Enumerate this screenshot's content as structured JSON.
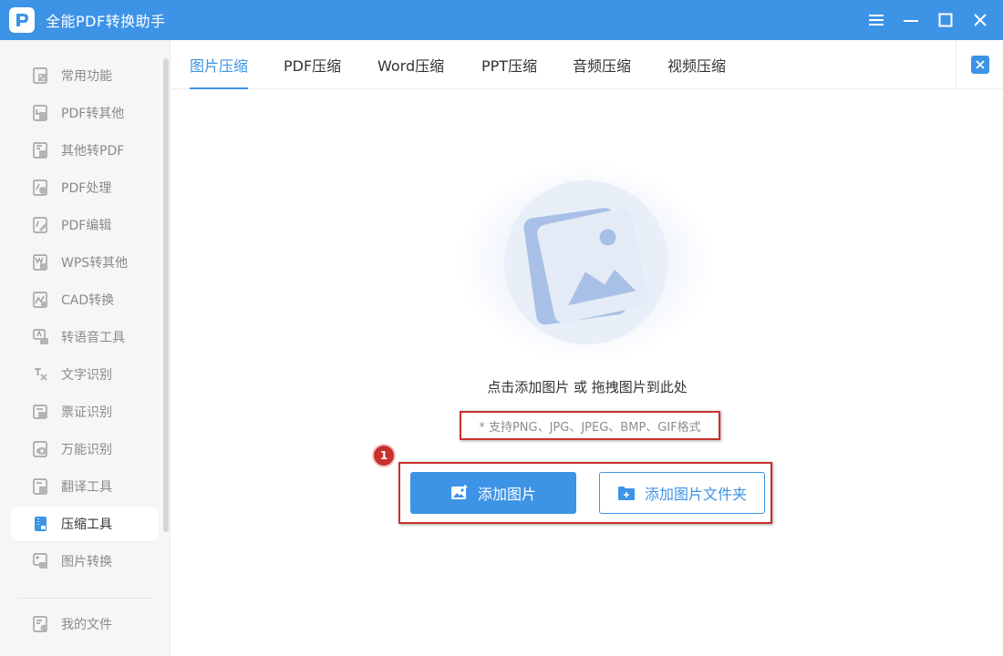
{
  "app": {
    "title": "全能PDF转换助手",
    "accent_color": "#3d93e6",
    "window_controls": [
      "menu-icon",
      "minimize-icon",
      "maximize-icon",
      "close-icon"
    ]
  },
  "sidebar": {
    "items": [
      {
        "label": "常用功能",
        "icon": "grid-doc-icon"
      },
      {
        "label": "PDF转其他",
        "icon": "pdf-export-icon"
      },
      {
        "label": "其他转PDF",
        "icon": "pdf-import-icon"
      },
      {
        "label": "PDF处理",
        "icon": "pdf-process-icon"
      },
      {
        "label": "PDF编辑",
        "icon": "pdf-edit-icon"
      },
      {
        "label": "WPS转其他",
        "icon": "wps-icon"
      },
      {
        "label": "CAD转换",
        "icon": "cad-icon"
      },
      {
        "label": "转语音工具",
        "icon": "audio-icon"
      },
      {
        "label": "文字识别",
        "icon": "ocr-text-icon"
      },
      {
        "label": "票证识别",
        "icon": "ticket-icon"
      },
      {
        "label": "万能识别",
        "icon": "eye-scan-icon"
      },
      {
        "label": "翻译工具",
        "icon": "translate-icon"
      },
      {
        "label": "压缩工具",
        "icon": "zip-icon",
        "active": true
      },
      {
        "label": "图片转换",
        "icon": "image-convert-icon"
      }
    ],
    "footer_item": {
      "label": "我的文件",
      "icon": "my-files-icon"
    }
  },
  "tabs": [
    {
      "label": "图片压缩",
      "active": true
    },
    {
      "label": "PDF压缩"
    },
    {
      "label": "Word压缩"
    },
    {
      "label": "PPT压缩"
    },
    {
      "label": "音频压缩"
    },
    {
      "label": "视频压缩"
    }
  ],
  "main": {
    "drop_hint": "点击添加图片 或 拖拽图片到此处",
    "formats": "* 支持PNG、JPG、JPEG、BMP、GIF格式",
    "step_badge": "1",
    "add_image_button": "添加图片",
    "add_folder_button": "添加图片文件夹"
  }
}
